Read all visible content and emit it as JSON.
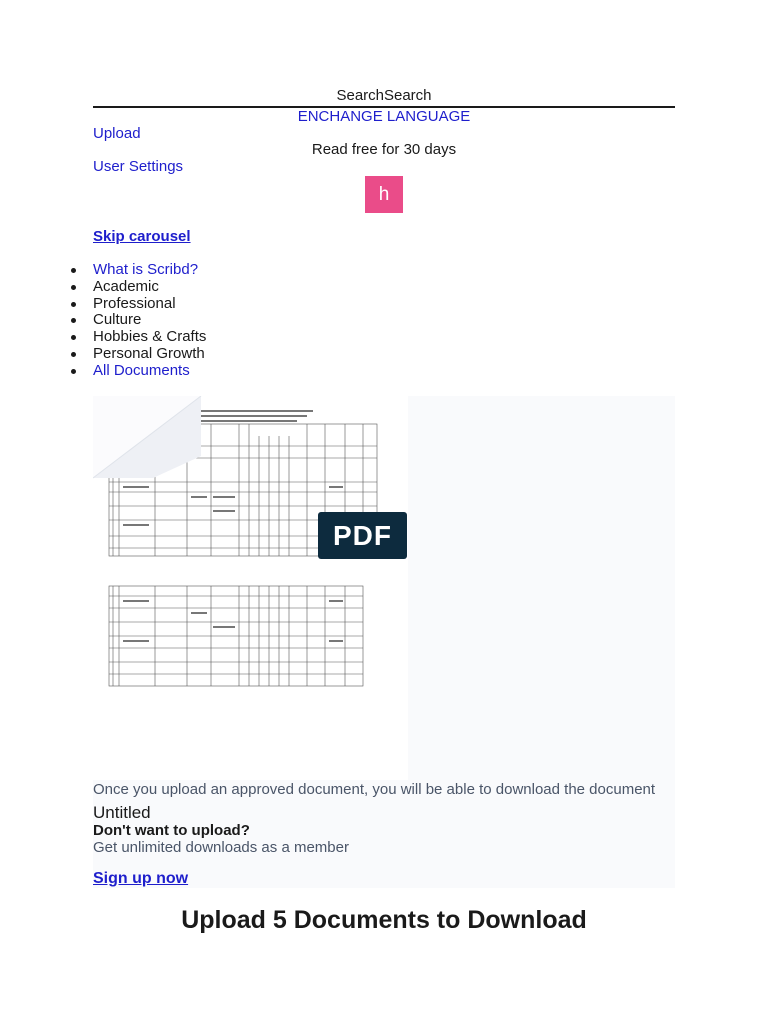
{
  "header": {
    "search_text": "SearchSearch",
    "language_link": "ENCHANGE LANGUAGE",
    "upload_link": "Upload",
    "user_settings_link": "User Settings",
    "read_free": "Read free for 30 days",
    "avatar_letter": "h"
  },
  "nav": {
    "skip_carousel": "Skip carousel",
    "categories": [
      {
        "label": "What is Scribd?"
      },
      {
        "label": "Academic"
      },
      {
        "label": "Professional"
      },
      {
        "label": "Culture"
      },
      {
        "label": "Hobbies & Crafts"
      },
      {
        "label": "Personal Growth"
      },
      {
        "label": "All Documents"
      }
    ]
  },
  "document": {
    "badge": "PDF",
    "approved_notice": "Once you upload an approved document, you will be able to download the document",
    "title": "Untitled",
    "no_upload_heading": "Don't want to upload?",
    "unlimited_text": "Get unlimited downloads as a member",
    "signup_link": "Sign up now"
  },
  "headline": "Upload 5 Documents to Download",
  "colors": {
    "link": "#1e1ecc",
    "avatar": "#ea4c89",
    "badge": "#0d2b3e",
    "panel": "#f9fafc"
  }
}
